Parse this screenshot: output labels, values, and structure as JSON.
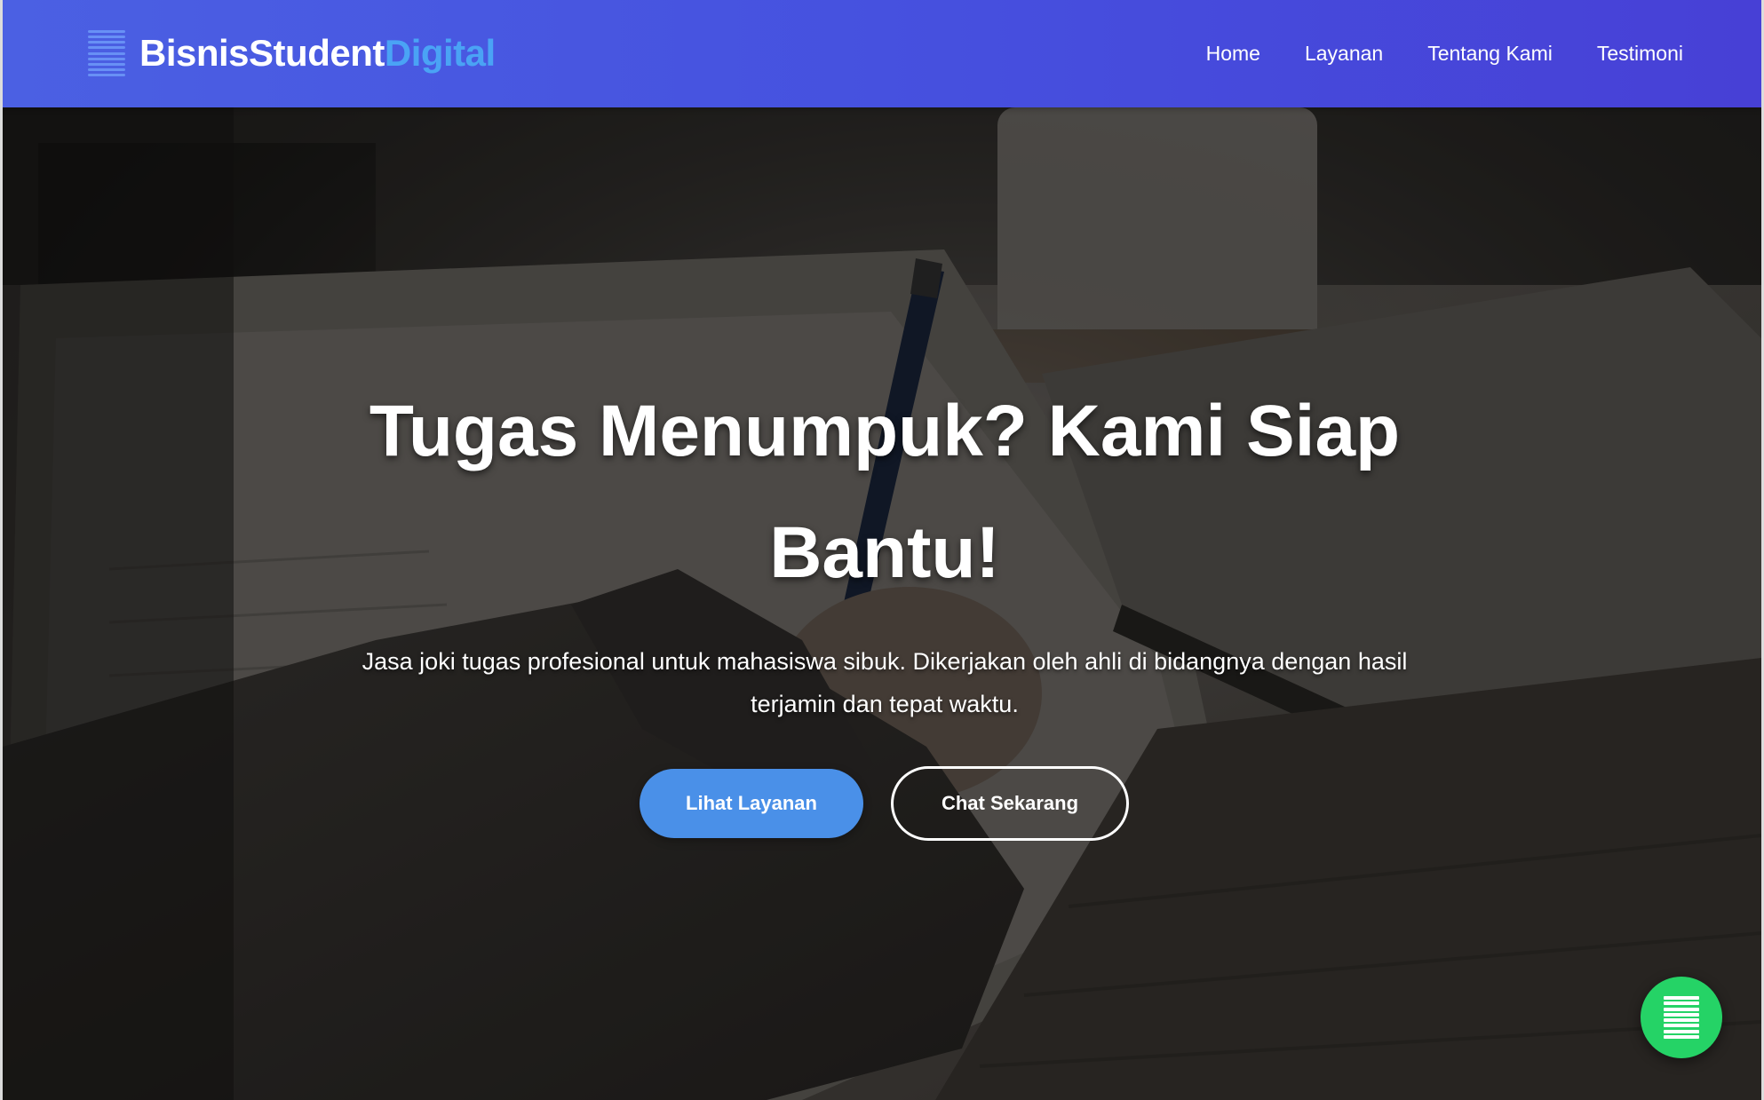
{
  "brand": {
    "name_main": "BisnisStudent",
    "name_accent": "Digital",
    "icon": "menu-lines-icon"
  },
  "nav": {
    "items": [
      {
        "label": "Home"
      },
      {
        "label": "Layanan"
      },
      {
        "label": "Tentang Kami"
      },
      {
        "label": "Testimoni"
      }
    ]
  },
  "hero": {
    "title": "Tugas Menumpuk? Kami Siap Bantu!",
    "subtitle": "Jasa joki tugas profesional untuk mahasiswa sibuk. Dikerjakan oleh ahli di bidangnya dengan hasil terjamin dan tepat waktu.",
    "primary_button": "Lihat Layanan",
    "secondary_button": "Chat Sekarang",
    "background_image": "student-writing-photo"
  },
  "floating_button": {
    "icon": "chat-lines-icon",
    "color": "#25d366"
  },
  "colors": {
    "navbar_start": "#4b60e3",
    "navbar_end": "#4740d6",
    "brand_accent": "#4aa3f5",
    "primary_button": "#4a90e8"
  }
}
